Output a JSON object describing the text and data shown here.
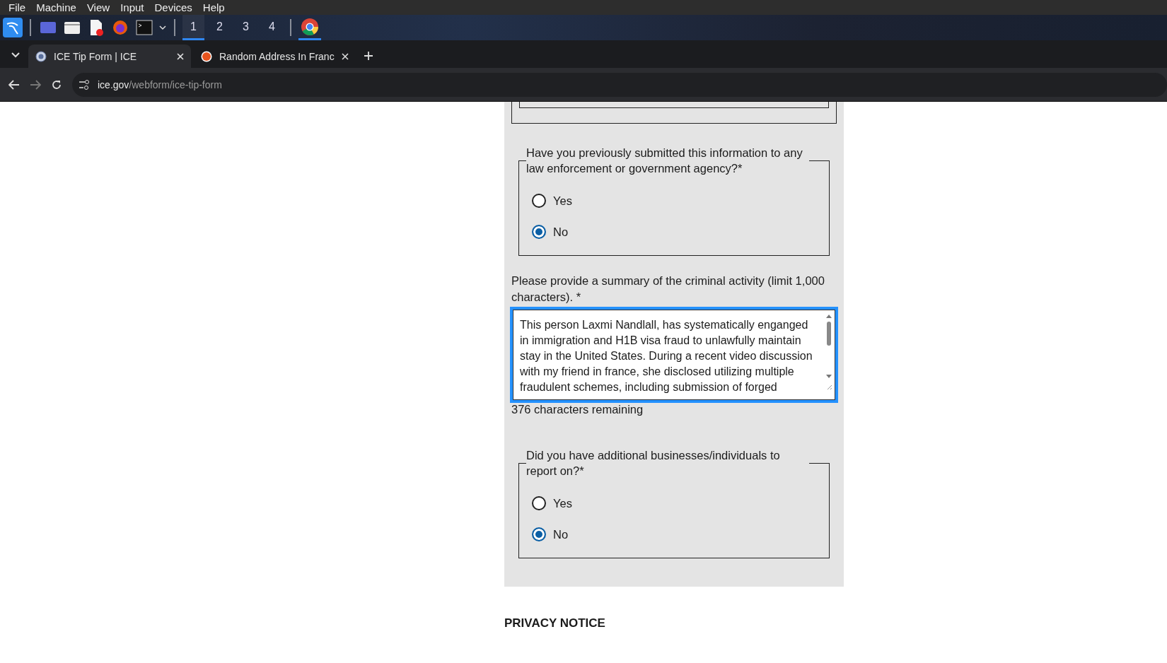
{
  "menu_bar": [
    "File",
    "Machine",
    "View",
    "Input",
    "Devices",
    "Help"
  ],
  "taskbar": {
    "workspaces": [
      {
        "label": "1",
        "selected": true
      },
      {
        "label": "2",
        "selected": false
      },
      {
        "label": "3",
        "selected": false
      },
      {
        "label": "4",
        "selected": false
      }
    ]
  },
  "browser_tabs": [
    {
      "title": "ICE Tip Form | ICE",
      "selected": true
    },
    {
      "title": "Random Address In Franc",
      "selected": false
    }
  ],
  "address_bar": {
    "domain": "ice.gov",
    "path": "/webform/ice-tip-form"
  },
  "form": {
    "questions": [
      {
        "kind": "radio",
        "label": "Have you previously submitted this information to any law enforcement or government agency?*",
        "options": [
          {
            "label": "Yes",
            "selected": false
          },
          {
            "label": "No",
            "selected": true
          }
        ]
      },
      {
        "kind": "textarea",
        "label": "Please provide a summary of the criminal activity (limit 1,000 characters). *",
        "value": "This person Laxmi Nandlall, has systematically enganged in immigration and H1B visa fraud to unlawfully maintain stay in the United States. During a recent video discussion with my friend in france, she disclosed utilizing multiple fraudulent schemes, including submission of forged",
        "counter": "376 characters remaining",
        "focused": true
      },
      {
        "kind": "radio",
        "label": "Did you have additional businesses/individuals to report on?*",
        "options": [
          {
            "label": "Yes",
            "selected": false
          },
          {
            "label": "No",
            "selected": true
          }
        ]
      }
    ]
  },
  "privacy_notice": {
    "heading": "PRIVACY NOTICE"
  }
}
